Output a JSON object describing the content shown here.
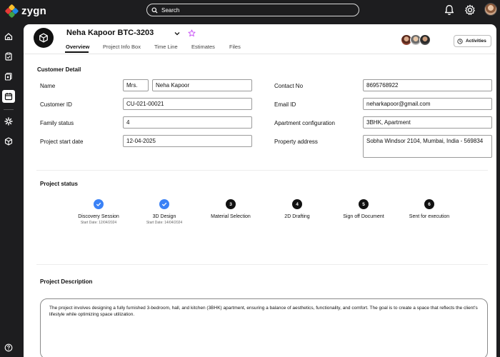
{
  "app": {
    "logo_text": "zygn",
    "logo_colors": [
      "#e53935",
      "#fbc02d",
      "#43a047",
      "#1e88e5"
    ],
    "search_placeholder": "Search"
  },
  "rail": {
    "items": [
      "home-icon",
      "clipboard-icon",
      "files-icon",
      "calendar-icon",
      "sparkle-icon",
      "cube-icon"
    ],
    "active": "calendar-icon",
    "bottom": "help-icon"
  },
  "header": {
    "title": "Neha Kapoor BTC-3203",
    "star_color": "#c64cf5",
    "tabs": [
      "Overview",
      "Project Info Box",
      "Time Line",
      "Estimates",
      "Files"
    ],
    "active_tab": "Overview",
    "activities_label": "Activities"
  },
  "customer_detail": {
    "title": "Customer Detail",
    "name_label": "Name",
    "salutation": "Mrs.",
    "name": "Neha Kapoor",
    "customer_id_label": "Customer ID",
    "customer_id": "CU-021-00021",
    "family_status_label": "Family status",
    "family_status": "4",
    "project_start_label": "Project start date",
    "project_start": "12-04-2025",
    "contact_label": "Contact No",
    "contact": "8695768922",
    "email_label": "Email ID",
    "email": "neharkapoor@gmail.com",
    "apartment_label": "Apartment configuration",
    "apartment": "3BHK, Apartment",
    "address_label": "Property address",
    "address": "Sobha Windsor 2104, Mumbai, India - 569834"
  },
  "project_status": {
    "title": "Project status",
    "done_color": "#3b82f6",
    "steps": [
      {
        "num": "",
        "label": "Discovery Session",
        "sub": "Start Date: 12/04/2024",
        "done": true
      },
      {
        "num": "",
        "label": "3D Design",
        "sub": "Start Date: 14/04/2024",
        "done": true
      },
      {
        "num": "3",
        "label": "Material Selection",
        "sub": "",
        "done": false
      },
      {
        "num": "4",
        "label": "2D Drafting",
        "sub": "",
        "done": false
      },
      {
        "num": "5",
        "label": "Sign off Document",
        "sub": "",
        "done": false
      },
      {
        "num": "6",
        "label": "Sent for execution",
        "sub": "",
        "done": false
      }
    ]
  },
  "project_description": {
    "title": "Project Description",
    "text": "The project involves designing a fully furnished 3-bedroom, hall, and kitchen (3BHK) apartment, ensuring a balance of aesthetics, functionality, and comfort. The goal is to create a space that reflects the client's lifestyle while optimizing space utilization."
  }
}
